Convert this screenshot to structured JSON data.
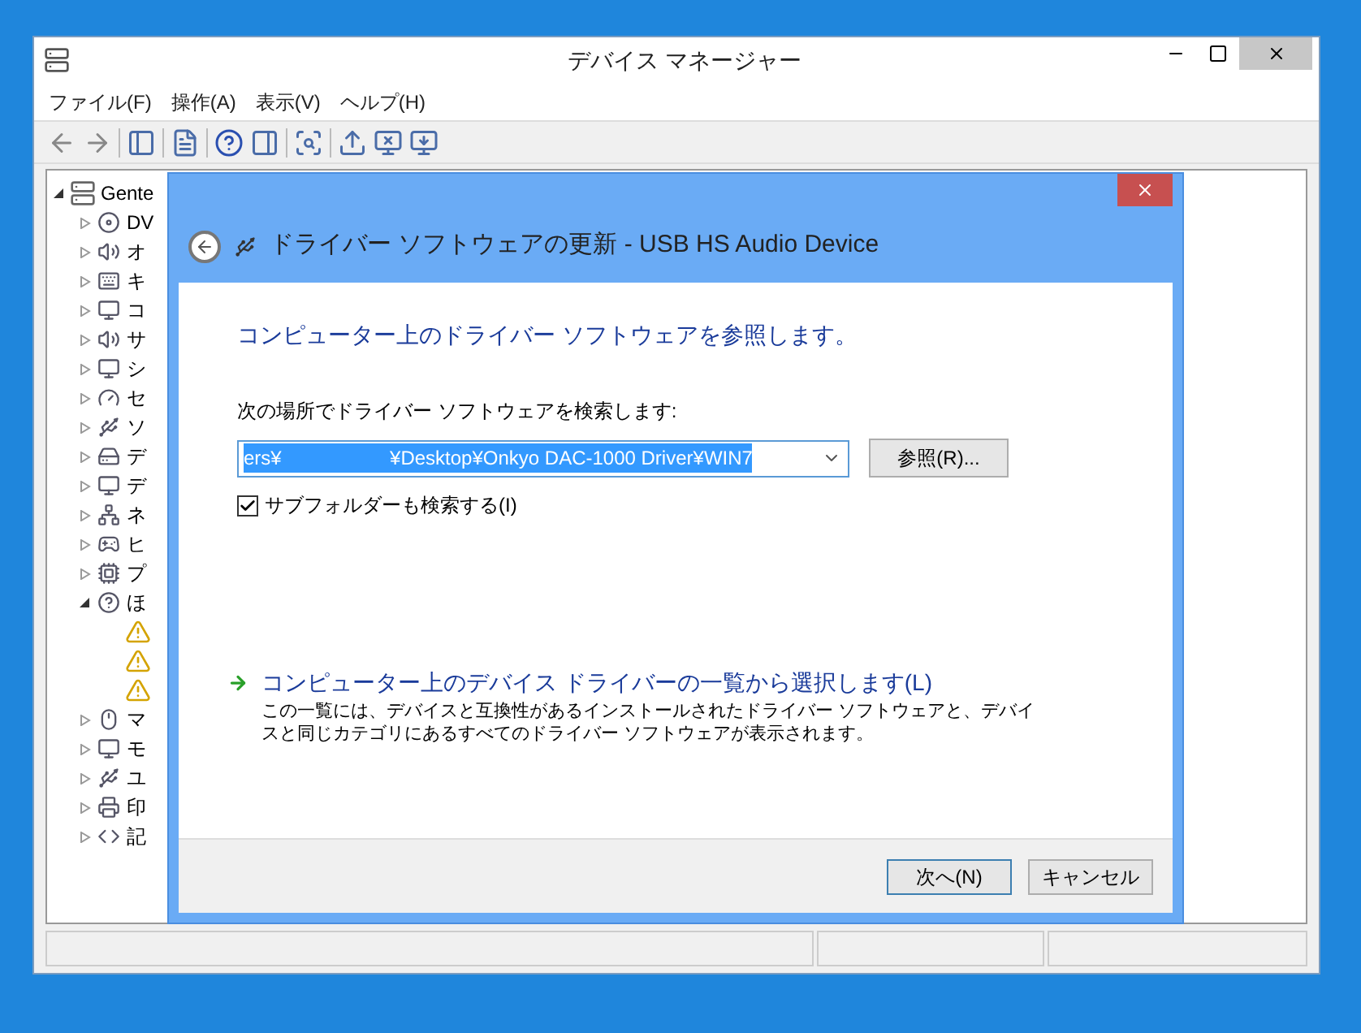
{
  "window": {
    "title": "デバイス マネージャー"
  },
  "menu": [
    "ファイル(F)",
    "操作(A)",
    "表示(V)",
    "ヘルプ(H)"
  ],
  "tree": {
    "label": "Gente",
    "expanded": true,
    "children": [
      {
        "label": "DV",
        "expanded": false
      },
      {
        "label": "オ",
        "expanded": false
      },
      {
        "label": "キ",
        "expanded": false
      },
      {
        "label": "コ",
        "expanded": false
      },
      {
        "label": "サ",
        "expanded": false
      },
      {
        "label": "シ",
        "expanded": false
      },
      {
        "label": "セ",
        "expanded": false
      },
      {
        "label": "ソ",
        "expanded": false
      },
      {
        "label": "デ",
        "expanded": false
      },
      {
        "label": "デ",
        "expanded": false
      },
      {
        "label": "ネ",
        "expanded": false
      },
      {
        "label": "ヒ",
        "expanded": false
      },
      {
        "label": "プ",
        "expanded": false
      },
      {
        "label": "ほ",
        "expanded": true,
        "children": [
          {
            "warning": true
          },
          {
            "warning": true
          },
          {
            "warning": true
          }
        ]
      },
      {
        "label": "マ",
        "expanded": false
      },
      {
        "label": "モ",
        "expanded": false
      },
      {
        "label": "ユ",
        "expanded": false
      },
      {
        "label": "印",
        "expanded": false
      },
      {
        "label": "記",
        "expanded": false
      }
    ]
  },
  "dialog": {
    "title": "ドライバー ソフトウェアの更新 - USB HS Audio Device",
    "heading": "コンピューター上のドライバー ソフトウェアを参照します。",
    "search_label": "次の場所でドライバー ソフトウェアを検索します:",
    "path": {
      "value": "ers¥                    ¥Desktop¥Onkyo DAC-1000 Driver¥WIN7",
      "selected": true
    },
    "browse_button": "参照(R)...",
    "subfolders": {
      "label": "サブフォルダーも検索する(I)",
      "checked": true
    },
    "pick_link": "コンピューター上のデバイス ドライバーの一覧から選択します(L)",
    "pick_description": "この一覧には、デバイスと互換性があるインストールされたドライバー ソフトウェアと、デバイスと同じカテゴリにあるすべてのドライバー ソフトウェアが表示されます。",
    "buttons": [
      {
        "label": "次へ(N)",
        "default": true
      },
      {
        "label": "キャンセル",
        "default": false
      }
    ]
  }
}
